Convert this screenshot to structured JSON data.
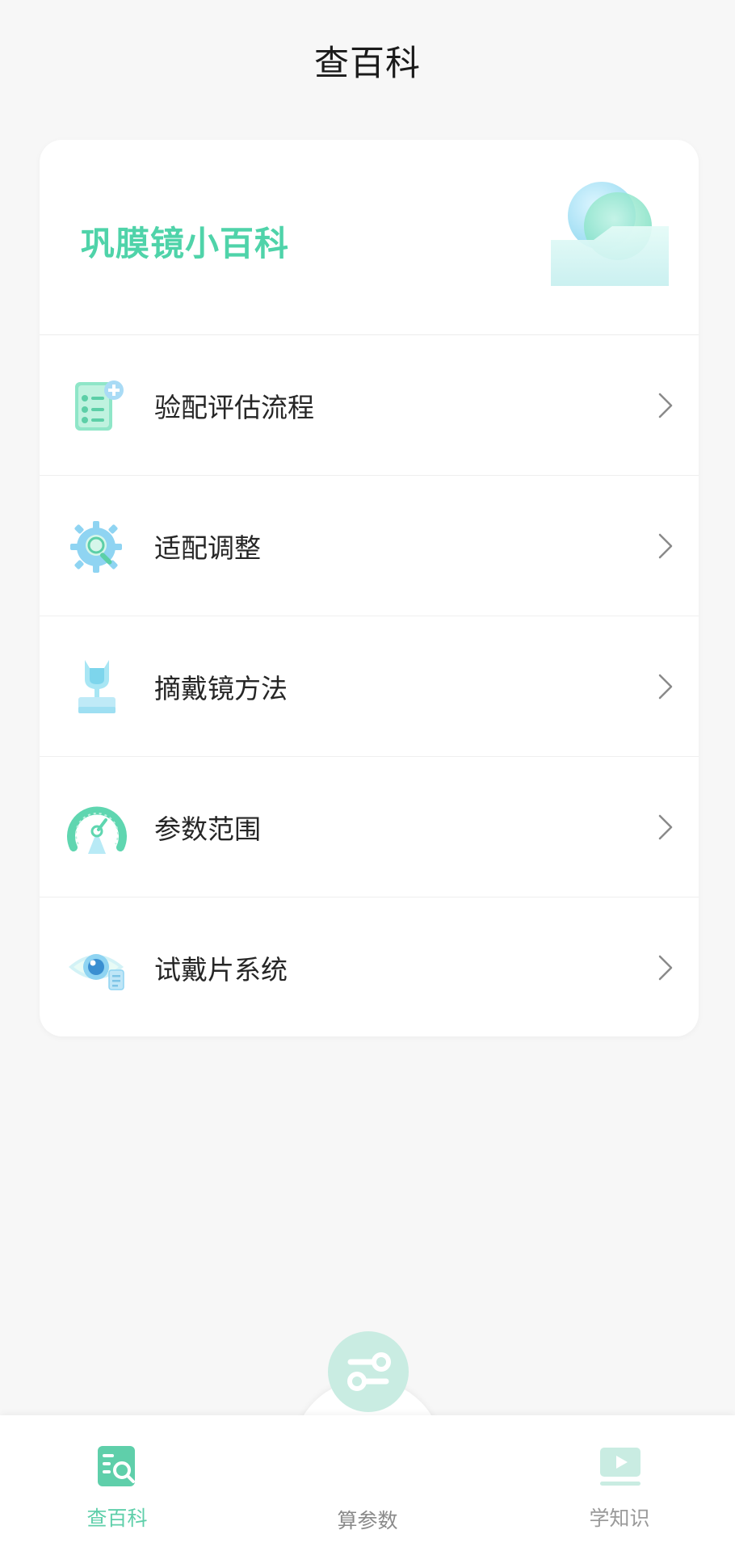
{
  "header": {
    "title": "查百科"
  },
  "card": {
    "heading": "巩膜镜小百科",
    "items": [
      {
        "label": "验配评估流程",
        "icon": "checklist-icon"
      },
      {
        "label": "适配调整",
        "icon": "gear-search-icon"
      },
      {
        "label": "摘戴镜方法",
        "icon": "lens-plunger-icon"
      },
      {
        "label": "参数范围",
        "icon": "gauge-icon"
      },
      {
        "label": "试戴片系统",
        "icon": "eye-document-icon"
      }
    ]
  },
  "tabbar": {
    "tabs": [
      {
        "label": "查百科",
        "icon": "document-search-icon",
        "active": true
      },
      {
        "label": "算参数",
        "icon": "sliders-icon",
        "active": false
      },
      {
        "label": "学知识",
        "icon": "video-play-icon",
        "active": false
      }
    ]
  },
  "colors": {
    "accent": "#4fd3a9",
    "active_tab": "#5fcfaa",
    "inactive_tab": "#9a9a9a",
    "background": "#f7f7f7"
  }
}
